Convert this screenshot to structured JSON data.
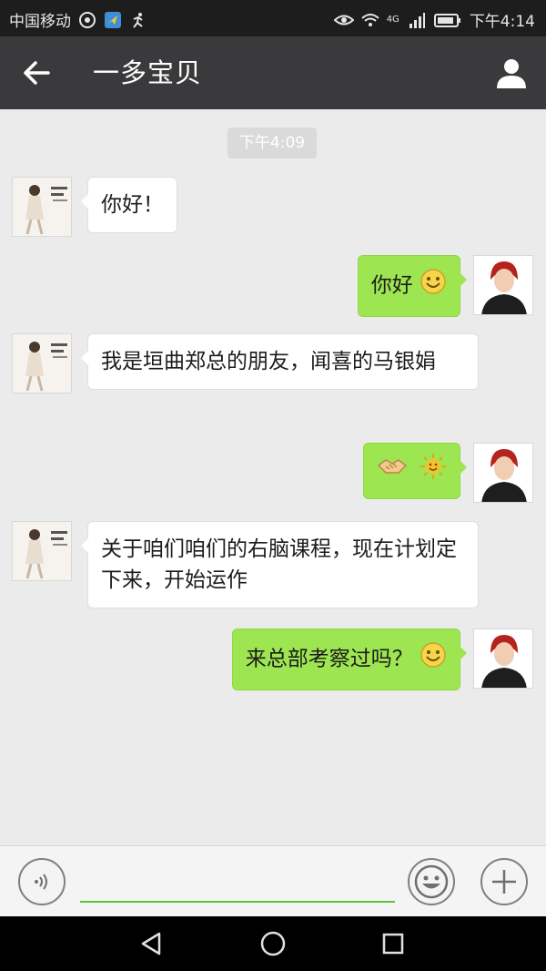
{
  "status_bar": {
    "carrier": "中国移动",
    "network": "4G",
    "time": "下午4:14"
  },
  "header": {
    "title": "一多宝贝"
  },
  "chat": {
    "timestamp": "下午4:09",
    "messages": [
      {
        "side": "in",
        "text": "你好！"
      },
      {
        "side": "out",
        "text": "你好",
        "emojis": [
          "smile-emoji"
        ]
      },
      {
        "side": "in",
        "text": "我是垣曲郑总的朋友，闻喜的马银娟"
      },
      {
        "side": "out",
        "text": "",
        "emojis": [
          "handshake-emoji",
          "sun-emoji"
        ]
      },
      {
        "side": "in",
        "text": "关于咱们咱们的右脑课程，现在计划定下来，开始运作"
      },
      {
        "side": "out",
        "text": "来总部考察过吗？",
        "emojis": [
          "smile-emoji"
        ]
      }
    ]
  },
  "input": {
    "value": ""
  },
  "colors": {
    "outgoing_bubble": "#9ee651",
    "incoming_bubble": "#ffffff",
    "chat_background": "#ebebeb",
    "title_bar": "#3a3a3c",
    "input_underline": "#5fc439"
  }
}
